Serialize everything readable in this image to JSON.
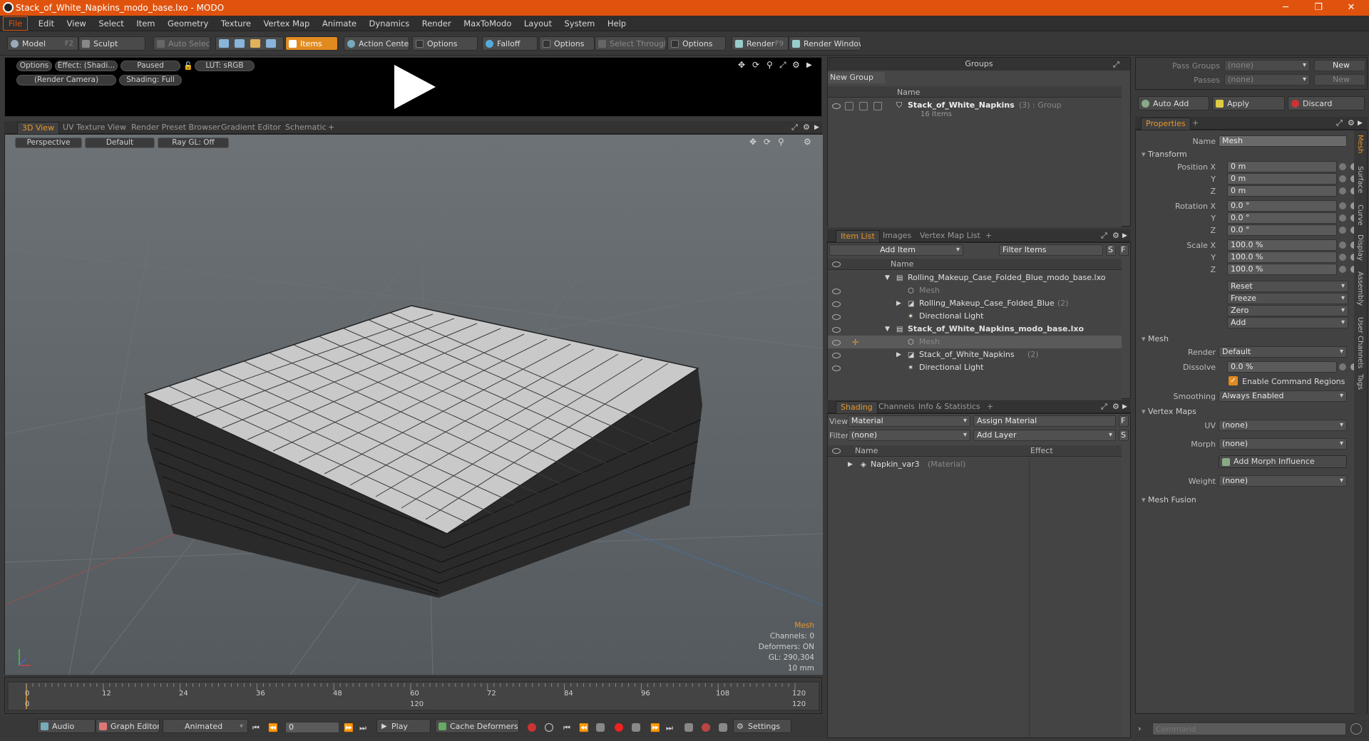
{
  "window": {
    "title": "Stack_of_White_Napkins_modo_base.lxo - MODO",
    "minimize": "─",
    "maximize": "❐",
    "close": "✕"
  },
  "menu": [
    "File",
    "Edit",
    "View",
    "Select",
    "Item",
    "Geometry",
    "Texture",
    "Vertex Map",
    "Animate",
    "Dynamics",
    "Render",
    "MaxToModo",
    "Layout",
    "System",
    "Help"
  ],
  "toolbar": {
    "model": "Model",
    "model_key": "F2",
    "sculpt": "Sculpt",
    "auto_select": "Auto Select",
    "items": "Items",
    "action_center": "Action Center",
    "options1": "Options",
    "falloff": "Falloff",
    "options2": "Options",
    "select_through": "Select Through",
    "options3": "Options",
    "render": "Render",
    "render_key": "F9",
    "render_window": "Render Window"
  },
  "preview": {
    "options": "Options",
    "effect": "Effect: (Shadi...",
    "paused": "Paused",
    "lut": "LUT: sRGB",
    "camera": "(Render Camera)",
    "shading": "Shading: Full"
  },
  "viewport_tabs": [
    "3D View",
    "UV Texture View",
    "Render Preset Browser",
    "Gradient Editor",
    "Schematic",
    "+"
  ],
  "viewport": {
    "perspective": "Perspective",
    "default": "Default",
    "raygl": "Ray GL: Off",
    "stats": {
      "label": "Mesh",
      "channels": "Channels: 0",
      "deformers": "Deformers: ON",
      "gl": "GL: 290,304",
      "scale": "10 mm"
    }
  },
  "timeline": {
    "ticks": [
      "0",
      "12",
      "24",
      "36",
      "48",
      "60",
      "72",
      "84",
      "96",
      "108",
      "120"
    ],
    "lower_ticks": [
      "0",
      "120",
      "120"
    ]
  },
  "bottombar": {
    "audio": "Audio",
    "graph_editor": "Graph Editor",
    "animated": "Animated",
    "frame": "0",
    "play": "Play",
    "cache_deformers": "Cache Deformers",
    "settings": "Settings"
  },
  "groups": {
    "title": "Groups",
    "new_group": "New Group",
    "col_name": "Name",
    "item_name": "Stack_of_White_Napkins",
    "item_suffix": "(3) : Group",
    "item_count": "16 Items"
  },
  "itemlist": {
    "tabs": [
      "Item List",
      "Images",
      "Vertex Map List",
      "+"
    ],
    "add_item": "Add Item",
    "filter": "Filter Items",
    "btn_s": "S",
    "btn_f": "F",
    "col_name": "Name",
    "rows": [
      {
        "text": "Rolling_Makeup_Case_Folded_Blue_modo_base.lxo",
        "suffix": ""
      },
      {
        "text": "Mesh",
        "suffix": ""
      },
      {
        "text": "Rolling_Makeup_Case_Folded_Blue",
        "suffix": "(2)"
      },
      {
        "text": "Directional Light",
        "suffix": ""
      },
      {
        "text": "Stack_of_White_Napkins_modo_base.lxo",
        "suffix": ""
      },
      {
        "text": "Mesh",
        "suffix": ""
      },
      {
        "text": "Stack_of_White_Napkins",
        "suffix": "(2)"
      },
      {
        "text": "Directional Light",
        "suffix": ""
      }
    ]
  },
  "shading": {
    "tabs": [
      "Shading",
      "Channels",
      "Info & Statistics",
      "+"
    ],
    "view_label": "View",
    "view_value": "Material",
    "assign_material": "Assign Material",
    "filter_label": "Filter",
    "filter_value": "(none)",
    "add_layer": "Add Layer",
    "btn_f": "F",
    "btn_s": "S",
    "col_name": "Name",
    "col_effect": "Effect",
    "item": "Napkin_var3",
    "item_suffix": "(Material)"
  },
  "passes": {
    "pass_groups": "Pass Groups",
    "pass_groups_value": "(none)",
    "passes": "Passes",
    "passes_value": "(none)",
    "new1": "New",
    "new2": "New"
  },
  "actions": {
    "auto_add": "Auto Add",
    "apply": "Apply",
    "discard": "Discard"
  },
  "properties": {
    "tab": "Properties",
    "plus": "+",
    "name_label": "Name",
    "name_value": "Mesh",
    "transform": "Transform",
    "position_label": "Position X",
    "rotation_label": "Rotation X",
    "scale_label": "Scale X",
    "y": "Y",
    "z": "Z",
    "pos": [
      "0 m",
      "0 m",
      "0 m"
    ],
    "rot": [
      "0.0 °",
      "0.0 °",
      "0.0 °"
    ],
    "scl": [
      "100.0 %",
      "100.0 %",
      "100.0 %"
    ],
    "reset": "Reset",
    "freeze": "Freeze",
    "zero": "Zero",
    "add": "Add",
    "mesh_section": "Mesh",
    "render_label": "Render",
    "render_value": "Default",
    "dissolve_label": "Dissolve",
    "dissolve_value": "0.0 %",
    "enable_command_regions": "Enable Command Regions",
    "smoothing_label": "Smoothing",
    "smoothing_value": "Always Enabled",
    "vertex_maps": "Vertex Maps",
    "uv_label": "UV",
    "uv_value": "(none)",
    "morph_label": "Morph",
    "morph_value": "(none)",
    "add_morph": "Add Morph Influence",
    "weight_label": "Weight",
    "weight_value": "(none)",
    "mesh_fusion": "Mesh Fusion",
    "side_tabs": [
      "Mesh",
      "Surface",
      "Curve",
      "Display",
      "Assembly",
      "User Channels",
      "Tags"
    ]
  },
  "command": {
    "placeholder": "Command"
  },
  "colors": {
    "accent": "#e0530e",
    "highlight": "#e5972f"
  }
}
